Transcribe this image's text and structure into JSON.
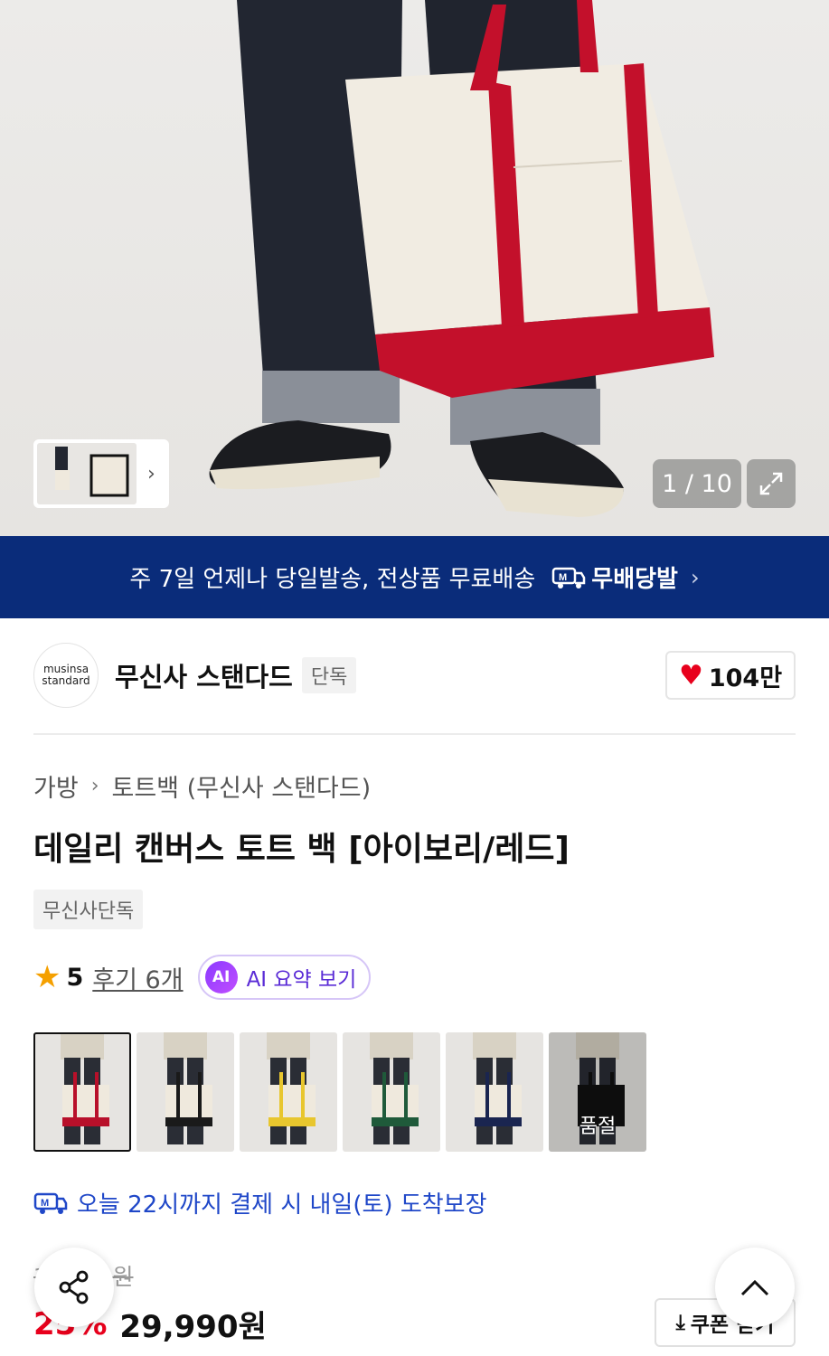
{
  "hero": {
    "counter": "1 / 10"
  },
  "banner": {
    "text": "주 7일 언제나 당일발송, 전상품 무료배송",
    "logo_label": "무배당발"
  },
  "brand": {
    "logo_line1": "musinsa",
    "logo_line2": "standard",
    "name": "무신사 스탠다드",
    "tag": "단독",
    "likes": "104만"
  },
  "breadcrumb": {
    "category": "가방",
    "subcategory": "토트백 (무신사 스탠다드)"
  },
  "product": {
    "title": "데일리 캔버스 토트 백 [아이보리/레드]",
    "exclusive_tag": "무신사단독",
    "rating": "5",
    "reviews": "후기 6개",
    "ai_badge": "AI",
    "ai_label": "AI 요약 보기"
  },
  "swatches": [
    {
      "color": "#b8102a",
      "selected": true
    },
    {
      "color": "#1a1a1a"
    },
    {
      "color": "#e8c62e"
    },
    {
      "color": "#1f5a3a"
    },
    {
      "color": "#1a2550"
    },
    {
      "color": "#111111",
      "soldout_label": "품절"
    }
  ],
  "delivery": {
    "text": "오늘 22시까지 결제 시 내일(토) 도착보장"
  },
  "price": {
    "original": "39,990원",
    "discount": "25%",
    "current": "29,990원",
    "coupon_label": "쿠폰 받기"
  },
  "colors": {
    "banner": "#0a2c7a",
    "accent_red": "#e8001c",
    "ai_purple": "#5a2bd6",
    "delivery_blue": "#1f47c8"
  }
}
